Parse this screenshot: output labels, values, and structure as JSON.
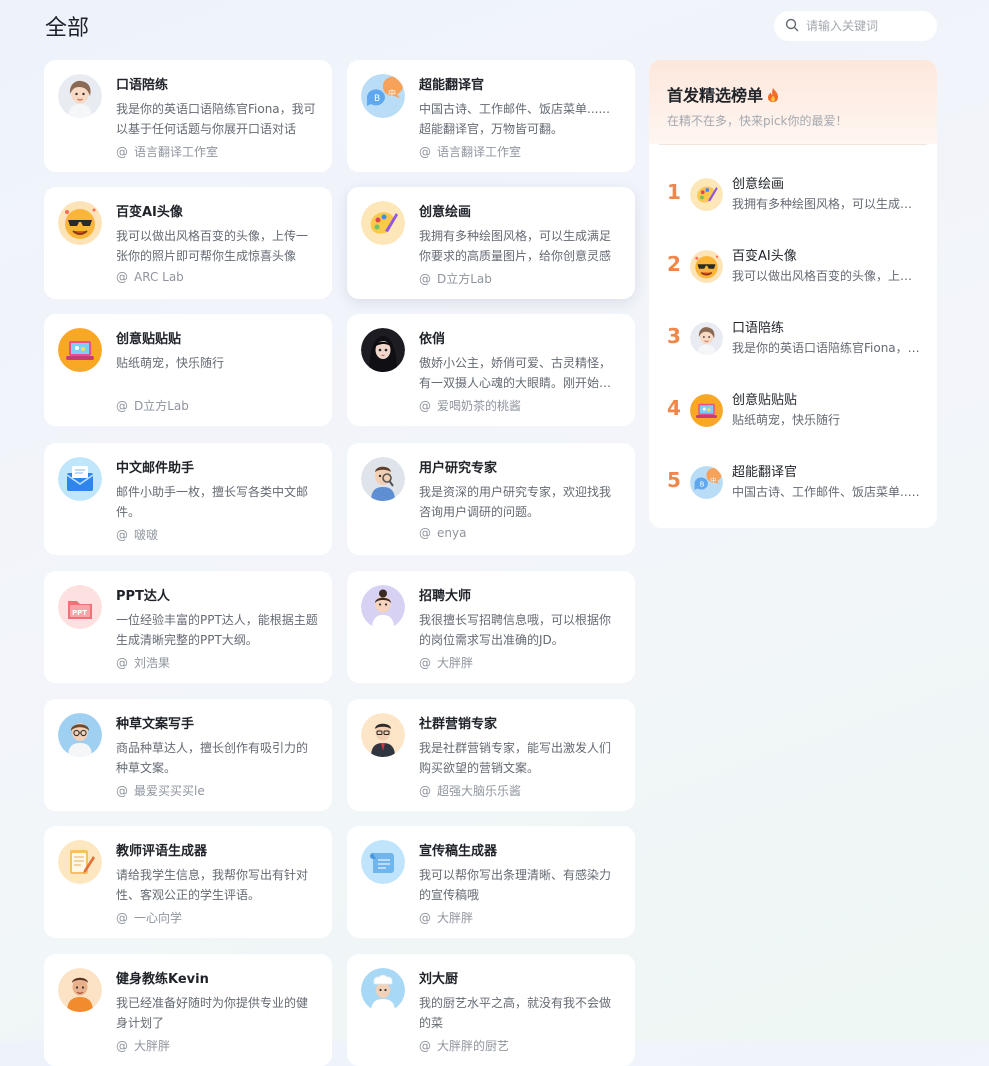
{
  "page": {
    "title": "全部",
    "search_placeholder": "请输入关键词"
  },
  "cards": [
    {
      "name": "口语陪练",
      "desc": "我是你的英语口语陪练官Fiona，我可以基于任何话题与你展开口语对话",
      "author": "语言翻译工作室",
      "icon": "woman-avatar-icon"
    },
    {
      "name": "超能翻译官",
      "desc": "中国古诗、工作邮件、饭店菜单......超能翻译官，万物皆可翻。",
      "author": "语言翻译工作室",
      "icon": "translate-bubbles-icon"
    },
    {
      "name": "百变AI头像",
      "desc": "我可以做出风格百变的头像，上传一张你的照片即可帮你生成惊喜头像",
      "author": "ARC Lab",
      "icon": "sunglasses-emoji-icon"
    },
    {
      "name": "创意绘画",
      "desc": "我拥有多种绘图风格，可以生成满足你要求的高质量图片，给你创意灵感",
      "author": "D立方Lab",
      "icon": "paint-palette-icon"
    },
    {
      "name": "创意贴贴贴",
      "desc": "贴纸萌宠，快乐随行",
      "author": "D立方Lab",
      "icon": "sticker-laptop-icon"
    },
    {
      "name": "依俏",
      "desc": "傲娇小公主，娇俏可爱、古灵精怪，有一双摄人心魂的大眼睛。刚开始有点高冷",
      "author": "爱喝奶茶的桃酱",
      "icon": "girl-portrait-icon"
    },
    {
      "name": "中文邮件助手",
      "desc": "邮件小助手一枚，擅长写各类中文邮件。",
      "author": "啵啵",
      "icon": "mail-envelope-icon"
    },
    {
      "name": "用户研究专家",
      "desc": "我是资深的用户研究专家，欢迎找我咨询用户调研的问题。",
      "author": "enya",
      "icon": "researcher-magnifier-icon"
    },
    {
      "name": "PPT达人",
      "desc": "一位经验丰富的PPT达人，能根据主题生成清晰完整的PPT大纲。",
      "author": "刘浩果",
      "icon": "ppt-folder-icon"
    },
    {
      "name": "招聘大师",
      "desc": "我很擅长写招聘信息哦，可以根据你的岗位需求写出准确的JD。",
      "author": "大胖胖",
      "icon": "recruiter-woman-icon"
    },
    {
      "name": "种草文案写手",
      "desc": "商品种草达人，擅长创作有吸引力的种草文案。",
      "author": "最爱买买买le",
      "icon": "writer-glasses-icon"
    },
    {
      "name": "社群营销专家",
      "desc": "我是社群营销专家，能写出激发人们购买欲望的营销文案。",
      "author": "超强大脑乐乐酱",
      "icon": "businessman-icon"
    },
    {
      "name": "教师评语生成器",
      "desc": "请给我学生信息，我帮你写出有针对性、客观公正的学生评语。",
      "author": "一心向学",
      "icon": "notepad-pencil-icon"
    },
    {
      "name": "宣传稿生成器",
      "desc": "我可以帮你写出条理清晰、有感染力的宣传稿哦",
      "author": "大胖胖",
      "icon": "scroll-paper-icon"
    },
    {
      "name": "健身教练Kevin",
      "desc": "我已经准备好随时为你提供专业的健身计划了",
      "author": "大胖胖",
      "icon": "fitness-coach-icon"
    },
    {
      "name": "刘大厨",
      "desc": "我的厨艺水平之高，就没有我不会做的菜",
      "author": "大胖胖的厨艺",
      "icon": "chef-hat-icon"
    }
  ],
  "ranking": {
    "title": "首发精选榜单",
    "subtitle": "在精不在多，快来pick你的最爱！",
    "items": [
      {
        "rank": "1",
        "name": "创意绘画",
        "desc": "我拥有多种绘图风格，可以生成满足你要求的高质量图片",
        "icon": "paint-palette-icon"
      },
      {
        "rank": "2",
        "name": "百变AI头像",
        "desc": "我可以做出风格百变的头像，上传一张你的照片即可",
        "icon": "sunglasses-emoji-icon"
      },
      {
        "rank": "3",
        "name": "口语陪练",
        "desc": "我是你的英语口语陪练官Fiona，我可以基于任何话题",
        "icon": "woman-avatar-icon"
      },
      {
        "rank": "4",
        "name": "创意贴贴贴",
        "desc": "贴纸萌宠，快乐随行",
        "icon": "sticker-laptop-icon"
      },
      {
        "rank": "5",
        "name": "超能翻译官",
        "desc": "中国古诗、工作邮件、饭店菜单......超能翻译官",
        "icon": "translate-bubbles-icon"
      }
    ]
  }
}
